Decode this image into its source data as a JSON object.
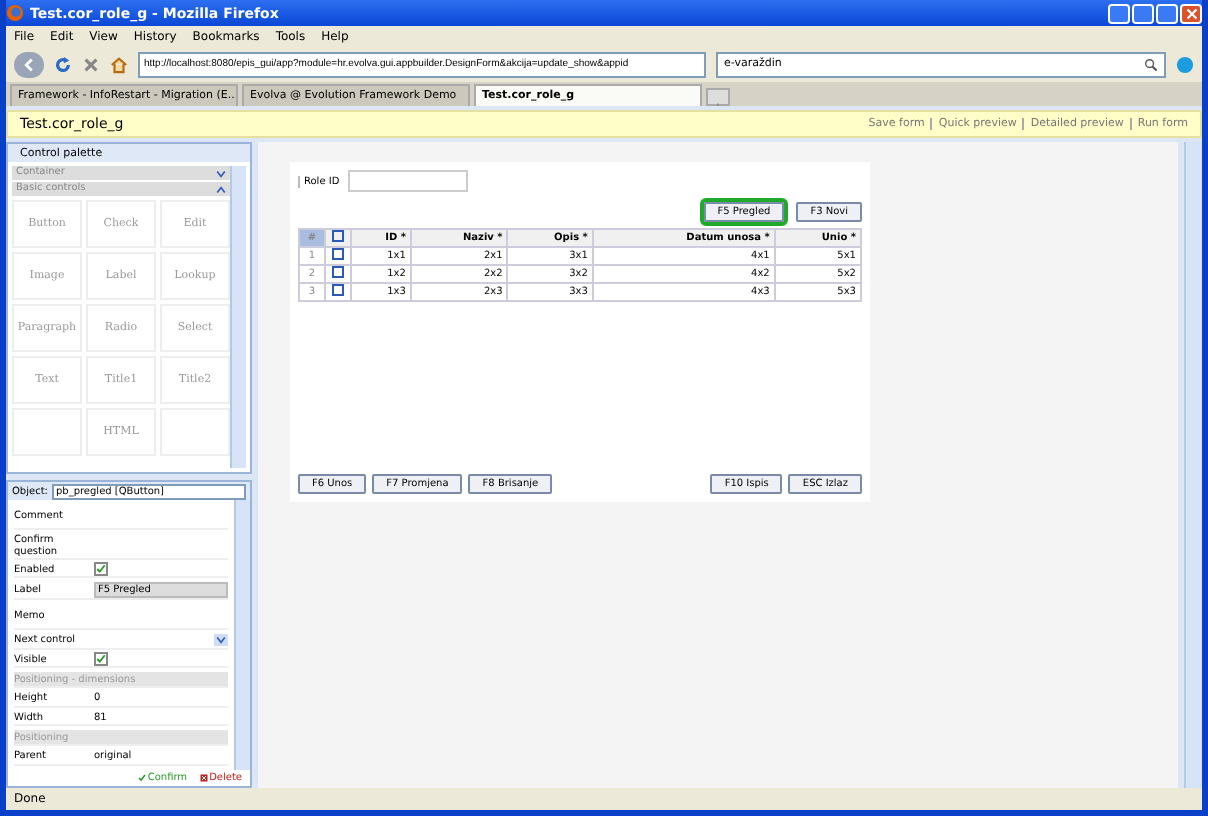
{
  "window": {
    "title": "Test.cor_role_g - Mozilla Firefox"
  },
  "menu": [
    "File",
    "Edit",
    "View",
    "History",
    "Bookmarks",
    "Tools",
    "Help"
  ],
  "address": {
    "value": "http://localhost:8080/epis_gui/app?module=hr.evolva.gui.appbuilder.DesignForm&akcija=update_show&appid"
  },
  "search": {
    "value": "e-varaždin"
  },
  "tabs": [
    {
      "label": "Framework - InfoRestart - Migration (E...",
      "selected": false
    },
    {
      "label": "Evolva @ Evolution Framework Demo",
      "selected": false
    },
    {
      "label": "Test.cor_role_g",
      "selected": true
    }
  ],
  "header": {
    "title": "Test.cor_role_g",
    "links": [
      "Save form",
      "Quick preview",
      "Detailed preview",
      "Run form"
    ]
  },
  "palette": {
    "title": "Control palette",
    "sections": [
      {
        "label": "Container",
        "expanded": false
      },
      {
        "label": "Basic controls",
        "expanded": true
      }
    ],
    "items": [
      {
        "kind": "control",
        "label": "Button"
      },
      {
        "kind": "control",
        "label": "Check"
      },
      {
        "kind": "control",
        "label": "Edit"
      },
      {
        "kind": "control",
        "label": "Image"
      },
      {
        "kind": "control",
        "label": "Label"
      },
      {
        "kind": "control",
        "label": "Lookup"
      },
      {
        "kind": "control",
        "label": "Paragraph"
      },
      {
        "kind": "control",
        "label": "Radio"
      },
      {
        "kind": "control",
        "label": "Select"
      },
      {
        "kind": "control",
        "label": "Text"
      },
      {
        "kind": "control",
        "label": "Title1"
      },
      {
        "kind": "control",
        "label": "Title2"
      },
      {
        "kind": "blank"
      },
      {
        "kind": "control",
        "label": "HTML"
      },
      {
        "kind": "blank"
      }
    ]
  },
  "properties": {
    "object_label": "Object:",
    "object": "pb_pregled [QButton]",
    "rows": [
      {
        "kind": "text",
        "label": "Comment"
      },
      {
        "kind": "text",
        "label": "Confirm question"
      },
      {
        "kind": "check",
        "label": "Enabled",
        "checked": true
      },
      {
        "kind": "input",
        "label": "Label",
        "value": "F5 Pregled"
      },
      {
        "kind": "text",
        "label": "Memo"
      },
      {
        "kind": "select",
        "label": "Next control"
      },
      {
        "kind": "check",
        "label": "Visible",
        "checked": true
      },
      {
        "kind": "section",
        "label": "Positioning - dimensions"
      },
      {
        "kind": "value",
        "label": "Height",
        "value": "0"
      },
      {
        "kind": "value",
        "label": "Width",
        "value": "81"
      },
      {
        "kind": "section",
        "label": "Positioning"
      },
      {
        "kind": "value",
        "label": "Parent",
        "value": "original"
      }
    ],
    "actions": [
      "Confirm",
      "Delete"
    ]
  },
  "form": {
    "field_label": "Role ID",
    "top_buttons": [
      {
        "label": "F5 Pregled",
        "selected": true
      },
      {
        "label": "F3 Novi",
        "selected": false
      }
    ],
    "table": {
      "columns": [
        "#",
        "ID *",
        "Naziv *",
        "Opis *",
        "Datum unosa *",
        "Unio *"
      ],
      "select_all_checked": false,
      "rows": [
        {
          "checked": false,
          "cells": [
            "1",
            "1x1",
            "2x1",
            "3x1",
            "4x1",
            "5x1"
          ]
        },
        {
          "checked": false,
          "cells": [
            "2",
            "1x2",
            "2x2",
            "3x2",
            "4x2",
            "5x2"
          ]
        },
        {
          "checked": false,
          "cells": [
            "3",
            "1x3",
            "2x3",
            "3x3",
            "4x3",
            "5x3"
          ]
        }
      ]
    },
    "bottom_left": [
      "F6 Unos",
      "F7 Promjena",
      "F8 Brisanje"
    ],
    "bottom_right": [
      "F10 Ispis",
      "ESC Izlaz"
    ]
  },
  "status_bar": {
    "text": "Done"
  }
}
